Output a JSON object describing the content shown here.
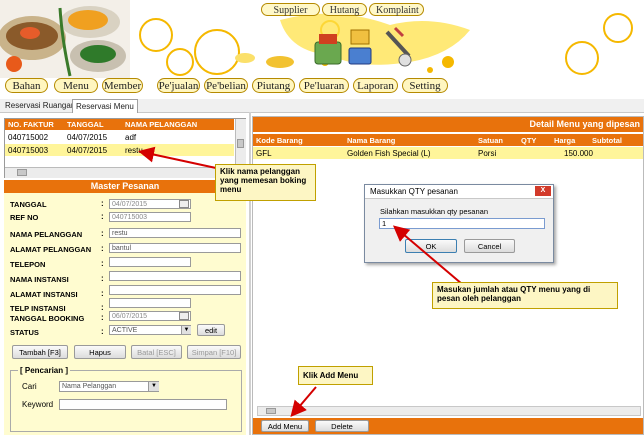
{
  "top_menu": [
    "Supplier",
    "Hutang",
    "Komplaint"
  ],
  "main_menu": [
    "Bahan",
    "Menu",
    "Member",
    "Pe'jualan",
    "Pe'belian",
    "Piutang",
    "Pe'luaran",
    "Laporan",
    "Setting"
  ],
  "tabs": [
    "Reservasi Ruangan",
    "Reservasi Menu"
  ],
  "booking_table": {
    "headers": [
      "NO. FAKTUR",
      "TANGGAL",
      "NAMA PELANGGAN"
    ],
    "rows": [
      [
        "040715002",
        "04/07/2015",
        "adf"
      ],
      [
        "040715003",
        "04/07/2015",
        "restu"
      ]
    ]
  },
  "master": {
    "title": "Master Pesanan",
    "fields": {
      "tanggal": {
        "label": "TANGGAL",
        "value": "04/07/2015"
      },
      "ref_no": {
        "label": "REF NO",
        "value": "040715003"
      },
      "nama_pelanggan": {
        "label": "NAMA PELANGGAN",
        "value": "restu"
      },
      "alamat_pelanggan": {
        "label": "ALAMAT PELANGGAN",
        "value": "bantul"
      },
      "telepon": {
        "label": "TELEPON",
        "value": ""
      },
      "nama_instansi": {
        "label": "NAMA INSTANSI",
        "value": ""
      },
      "alamat_instansi": {
        "label": "ALAMAT INSTANSI",
        "value": ""
      },
      "telp_instansi": {
        "label": "TELP INSTANSI",
        "value": ""
      },
      "tanggal_booking": {
        "label": "TANGGAL BOOKING",
        "value": "06/07/2015"
      },
      "status": {
        "label": "STATUS",
        "value": "ACTIVE"
      }
    },
    "colon": ":",
    "edit_label": "edit",
    "buttons": {
      "tambah": "Tambah [F3]",
      "hapus": "Hapus",
      "batal": "Batal [ESC]",
      "simpan": "Simpan [F10]"
    }
  },
  "search": {
    "legend": "[ Pencarian ]",
    "cari_label": "Cari",
    "cari_value": "Nama Pelanggan",
    "keyword_label": "Keyword",
    "keyword_value": ""
  },
  "detail": {
    "title": "Detail Menu yang dipesan",
    "headers": [
      "Kode Barang",
      "Nama Barang",
      "Satuan",
      "QTY",
      "Harga",
      "Subtotal"
    ],
    "rows": [
      [
        "GFL",
        "Golden Fish Special (L)",
        "Porsi",
        "",
        "150.000",
        ""
      ]
    ],
    "add_label": "Add Menu",
    "delete_label": "Delete"
  },
  "dialog": {
    "title": "Masukkan QTY pesanan",
    "close": "X",
    "prompt": "Silahkan masukkan qty pesanan",
    "value": "1",
    "ok": "OK",
    "cancel": "Cancel"
  },
  "callouts": {
    "click_customer": "Klik nama pelanggan yang memesan boking menu",
    "enter_qty": "Masukan jumlah atau QTY menu yang di pesan oleh pelanggan",
    "click_add": "Klik Add Menu"
  },
  "colors": {
    "accent": "#e8720c",
    "panel": "#fffcd0",
    "callout_arrow": "#d40000"
  }
}
